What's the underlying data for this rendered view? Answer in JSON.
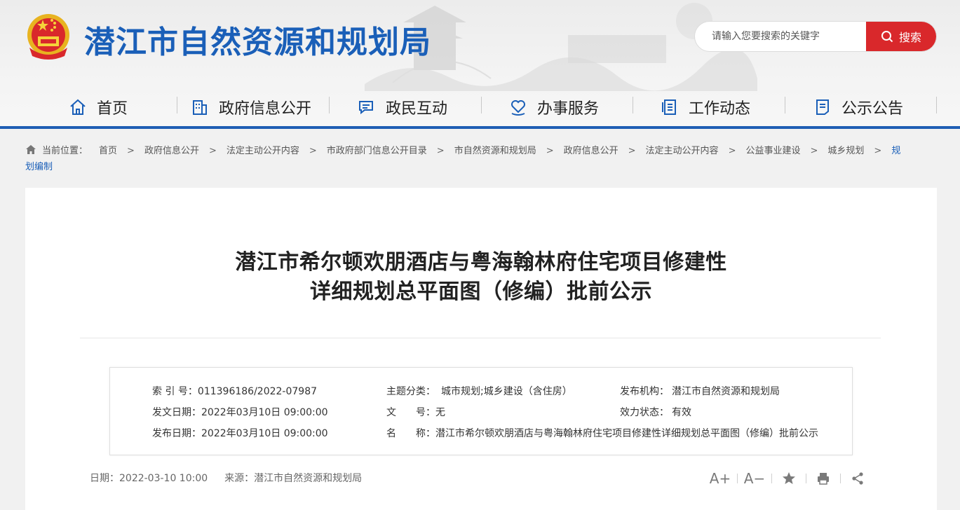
{
  "site": {
    "title": "潜江市自然资源和规划局"
  },
  "search": {
    "placeholder": "请输入您要搜索的关键字",
    "button_label": "搜索"
  },
  "nav": {
    "items": [
      {
        "label": "首页",
        "icon": "home-icon"
      },
      {
        "label": "政府信息公开",
        "icon": "building-icon"
      },
      {
        "label": "政民互动",
        "icon": "chat-icon"
      },
      {
        "label": "办事服务",
        "icon": "heart-hand-icon"
      },
      {
        "label": "工作动态",
        "icon": "document-list-icon"
      },
      {
        "label": "公示公告",
        "icon": "notice-icon"
      }
    ]
  },
  "breadcrumb": {
    "prefix": "当前位置：",
    "items": [
      "首页",
      "政府信息公开",
      "法定主动公开内容",
      "市政府部门信息公开目录",
      "市自然资源和规划局",
      "政府信息公开",
      "法定主动公开内容",
      "公益事业建设",
      "城乡规划",
      "规划编制"
    ],
    "separator": ">"
  },
  "article": {
    "title_line1": "潜江市希尔顿欢朋酒店与粤海翰林府住宅项目修建性",
    "title_line2": "详细规划总平面图（修编）批前公示"
  },
  "meta": {
    "index_label": "索 引 号：",
    "index_value": "011396186/2022-07987",
    "topic_label": "主题分类：",
    "topic_value": "城市规划;城乡建设（含住房）",
    "publisher_label": "发布机构：",
    "publisher_value": "潜江市自然资源和规划局",
    "issue_date_label": "发文日期：",
    "issue_date_value": "2022年03月10日 09:00:00",
    "doc_no_label": "文　　号：",
    "doc_no_value": "无",
    "validity_label": "效力状态：",
    "validity_value": "有效",
    "publish_date_label": "发布日期：",
    "publish_date_value": "2022年03月10日 09:00:00",
    "name_label": "名　　称：",
    "name_value": "潜江市希尔顿欢朋酒店与粤海翰林府住宅项目修建性详细规划总平面图（修编）批前公示"
  },
  "footer": {
    "date_text": "日期：2022-03-10 10:00",
    "source_text": "来源：潜江市自然资源和规划局"
  },
  "tools": {
    "font_increase": "A+",
    "font_decrease": "A−",
    "icons": [
      "font-increase-icon",
      "font-decrease-icon",
      "star-icon",
      "print-icon",
      "share-icon"
    ]
  },
  "colors": {
    "brand_blue": "#1a5fb8",
    "nav_bar": "#1f5eb4",
    "search_red": "#d9282b"
  }
}
